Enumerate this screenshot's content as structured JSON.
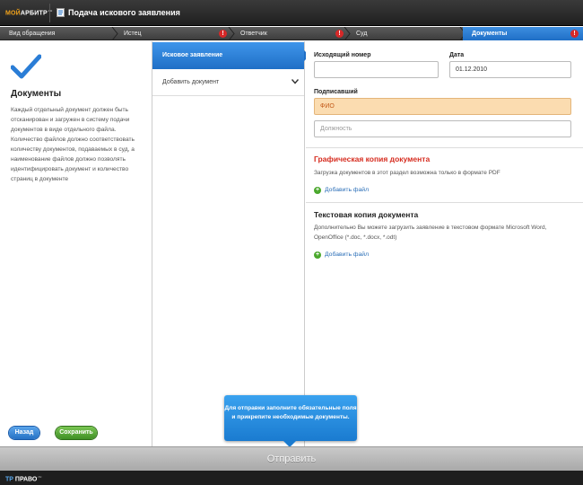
{
  "header": {
    "logo_brand": "МОЙ",
    "logo_name": "АРБИТР",
    "logo_suffix": ".ru",
    "title": "Подача искового заявления"
  },
  "steps": [
    {
      "label": "Вид обращения",
      "warning": false,
      "active": false
    },
    {
      "label": "Истец",
      "warning": true,
      "active": false
    },
    {
      "label": "Ответчик",
      "warning": true,
      "active": false
    },
    {
      "label": "Суд",
      "warning": false,
      "active": false
    },
    {
      "label": "Документы",
      "warning": true,
      "active": true
    }
  ],
  "warning_glyph": "!",
  "left": {
    "title": "Документы",
    "description": "Каждый отдельный документ должен быть отсканирован и загружен в систему подачи документов в виде отдельного файла. Количество файлов должно соответствовать количеству документов, подаваемых в суд, а наименование файлов должно позволять идентифицировать документ и количество страниц в документе",
    "back_label": "Назад",
    "save_label": "Сохранить"
  },
  "middle": {
    "active_item": "Исковое заявление",
    "add_item": "Добавить документ"
  },
  "form": {
    "outgoing_number_label": "Исходящий номер",
    "outgoing_number_value": "",
    "date_label": "Дата",
    "date_value": "01.12.2010",
    "signer_label": "Подписавший",
    "signer_name_placeholder": "ФИО",
    "signer_position_placeholder": "Должность"
  },
  "graphic_copy": {
    "title": "Графическая копия документа",
    "description": "Загрузка документов в этот раздел возможна только в формате PDF",
    "add_file_label": "Добавить файл"
  },
  "text_copy": {
    "title": "Текстовая копия документа",
    "description": "Дополнительно Вы можете загрузить заявление в текстовом формате Microsoft Word, OpenOffice (*.doc, *.docx, *.odt)",
    "add_file_label": "Добавить файл"
  },
  "tooltip": {
    "text": "Для отправки заполните обязательные поля и прикрепите необходимые документы."
  },
  "submit": {
    "label": "Отправить"
  },
  "footer": {
    "logo_prefix": "ТР",
    "logo_name": "ПРАВО",
    "logo_suffix": ".ru"
  },
  "colors": {
    "accent_blue": "#1f6fc6",
    "required_field": "#fbdcb0",
    "section_red": "#d62c1f",
    "save_green": "#4aa82c"
  }
}
